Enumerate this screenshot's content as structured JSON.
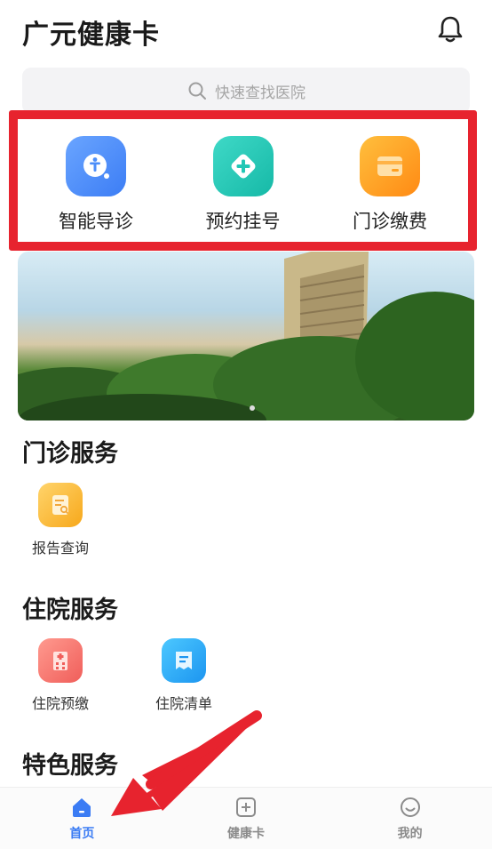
{
  "header": {
    "title": "广元健康卡",
    "notification_icon": "bell-icon"
  },
  "search": {
    "placeholder": "快速查找医院",
    "icon": "search-icon"
  },
  "quick_actions": [
    {
      "label": "智能导诊",
      "icon": "person-guide-icon",
      "color": "#4d8ef9"
    },
    {
      "label": "预约挂号",
      "icon": "medical-cross-icon",
      "color": "#22c7b5"
    },
    {
      "label": "门诊缴费",
      "icon": "card-icon",
      "color": "#ff9f1f"
    }
  ],
  "sections": [
    {
      "title": "门诊服务",
      "items": [
        {
          "label": "报告查询",
          "icon": "report-icon"
        }
      ]
    },
    {
      "title": "住院服务",
      "items": [
        {
          "label": "住院预缴",
          "icon": "hospital-icon"
        },
        {
          "label": "住院清单",
          "icon": "list-icon"
        }
      ]
    },
    {
      "title": "特色服务",
      "items": []
    }
  ],
  "tabbar": {
    "items": [
      {
        "label": "首页",
        "icon": "home-icon",
        "active": true
      },
      {
        "label": "健康卡",
        "icon": "health-card-icon",
        "active": false
      },
      {
        "label": "我的",
        "icon": "smiley-icon",
        "active": false
      }
    ]
  },
  "colors": {
    "accent": "#3b7cf4",
    "highlight": "#e7232e"
  }
}
